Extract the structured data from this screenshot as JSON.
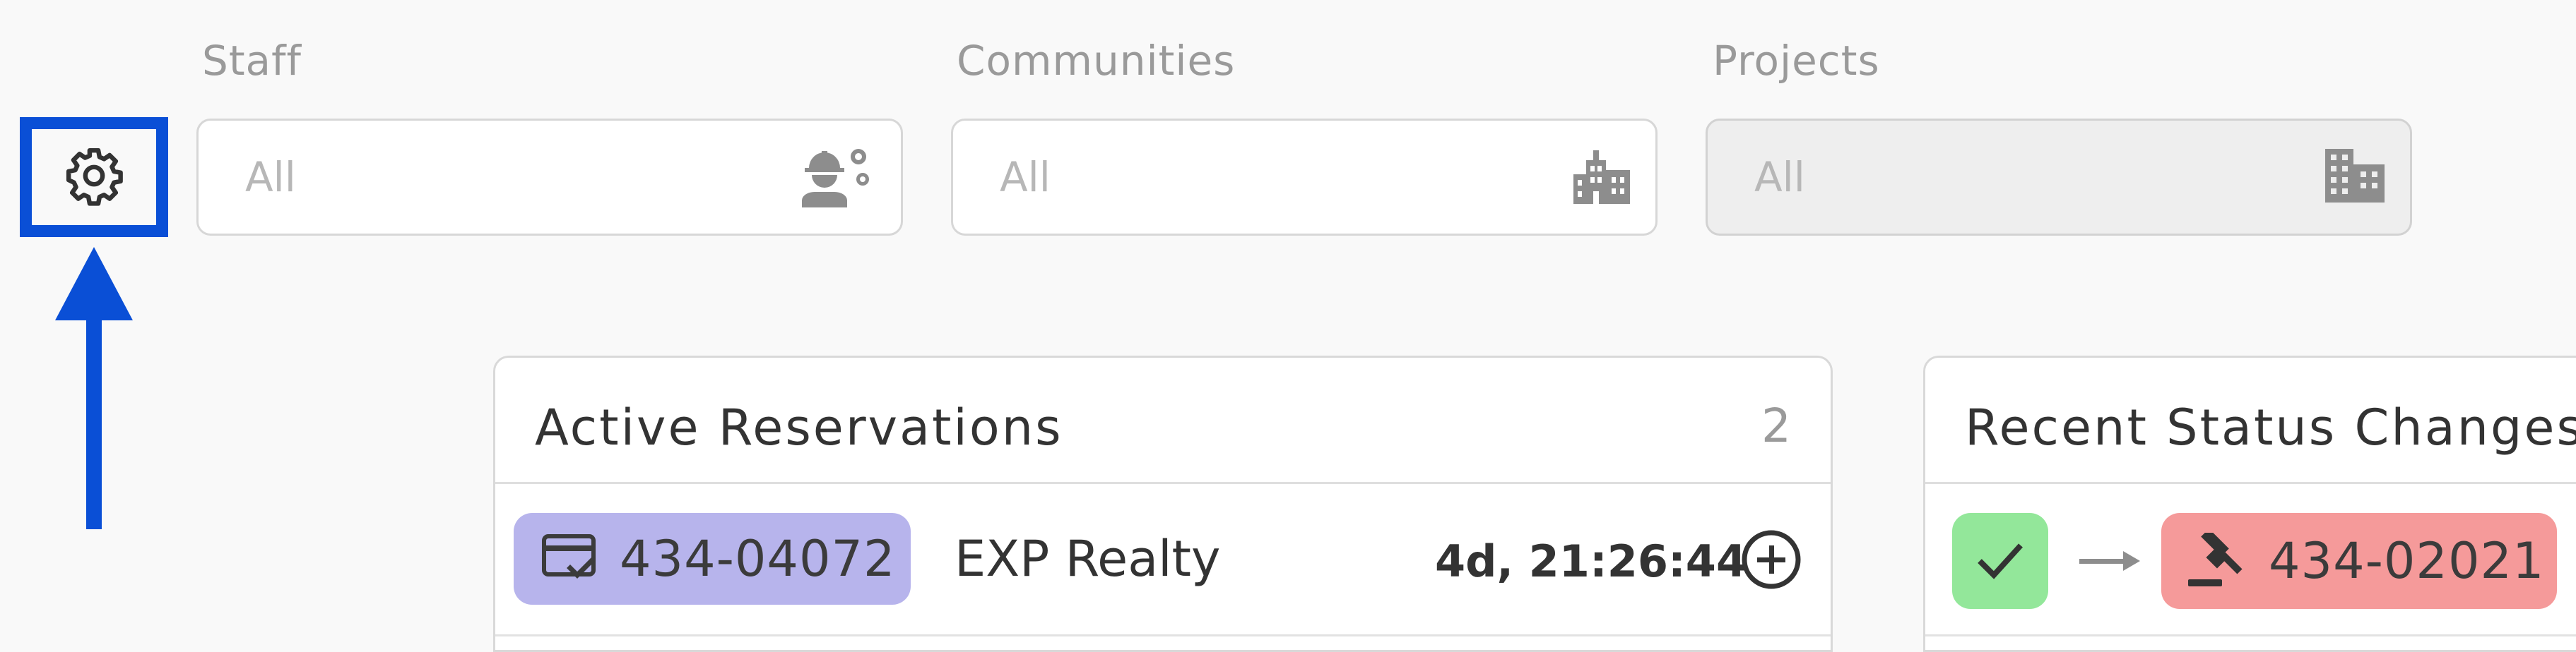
{
  "filters": {
    "staff": {
      "label": "Staff",
      "placeholder": "All",
      "icon": "worker-gears-icon"
    },
    "communities": {
      "label": "Communities",
      "placeholder": "All",
      "icon": "city-icon"
    },
    "projects": {
      "label": "Projects",
      "placeholder": "All",
      "icon": "building-icon",
      "disabled": true
    }
  },
  "settings": {
    "icon": "gear-icon",
    "highlight_color": "#0a4fd6"
  },
  "active_reservations": {
    "title": "Active Reservations",
    "count": "2",
    "rows": [
      {
        "icon": "card-check-icon",
        "code": "434-04072",
        "company": "EXP Realty",
        "countdown": "4d, 21:26:44",
        "action_icon": "plus-circle-icon",
        "pill_color": "#b7b4ec"
      }
    ]
  },
  "recent_status_changes": {
    "title": "Recent Status Changes",
    "rows": [
      {
        "from_icon": "check-icon",
        "from_color": "#93e79a",
        "arrow_icon": "arrow-right-icon",
        "to_icon": "gavel-icon",
        "code": "434-02021",
        "to_color": "#f59a9a"
      }
    ]
  }
}
